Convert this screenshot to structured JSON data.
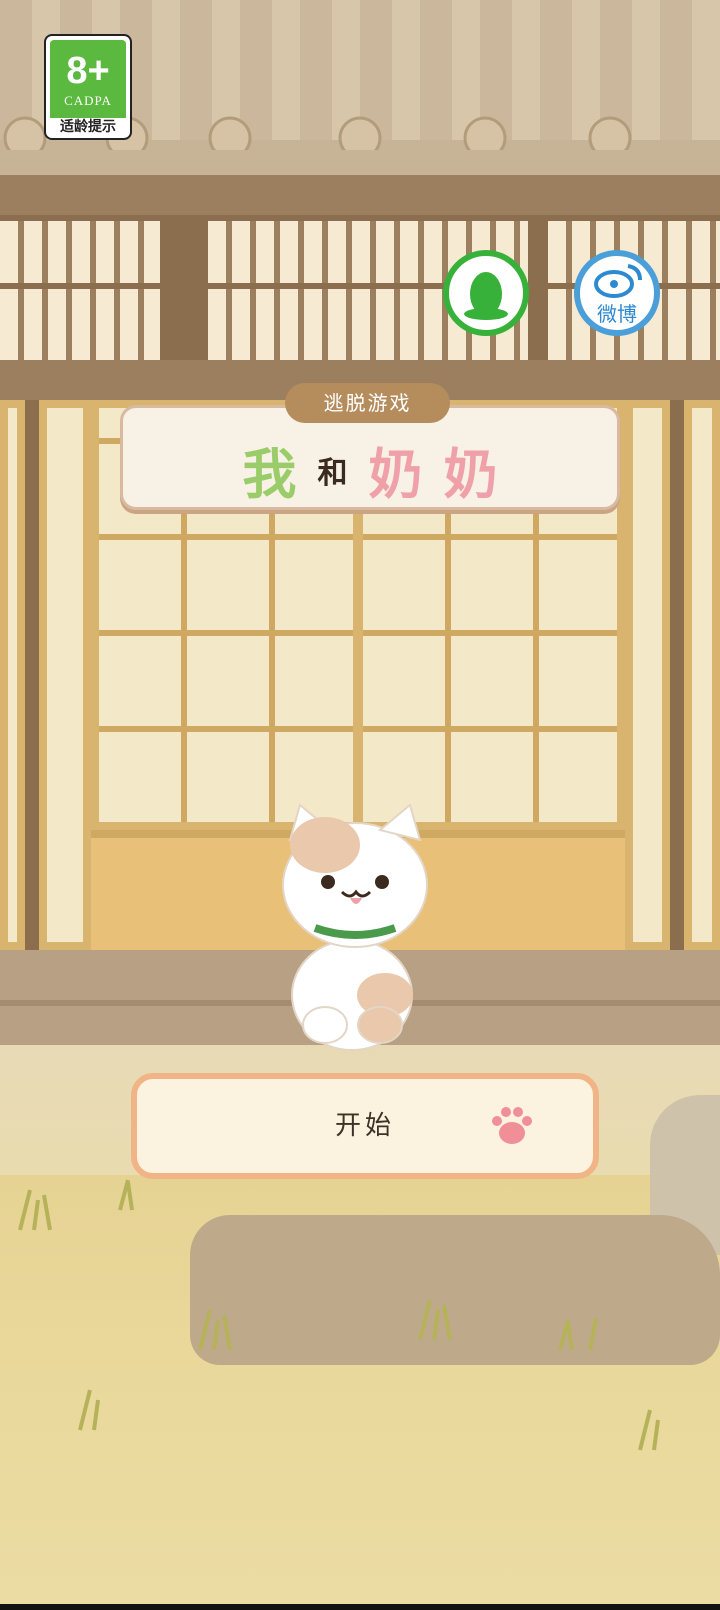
{
  "age_rating": {
    "age": "8+",
    "org": "CADPA",
    "hint": "适龄提示"
  },
  "social": {
    "qq_icon": "qq-penguin-icon",
    "weibo_icon": "weibo-icon",
    "weibo_label": "微博"
  },
  "title": {
    "tag": "逃脱游戏",
    "chars": [
      {
        "text": "我",
        "color": "#9bcc6a"
      },
      {
        "text": "和",
        "color": "#3b2a1e"
      },
      {
        "text": "奶",
        "color": "#f0a0a8"
      },
      {
        "text": "奶",
        "color": "#f0a0a8"
      }
    ]
  },
  "start_button": {
    "label": "开始",
    "icon": "paw-icon"
  },
  "character": {
    "icon": "cat-icon"
  }
}
